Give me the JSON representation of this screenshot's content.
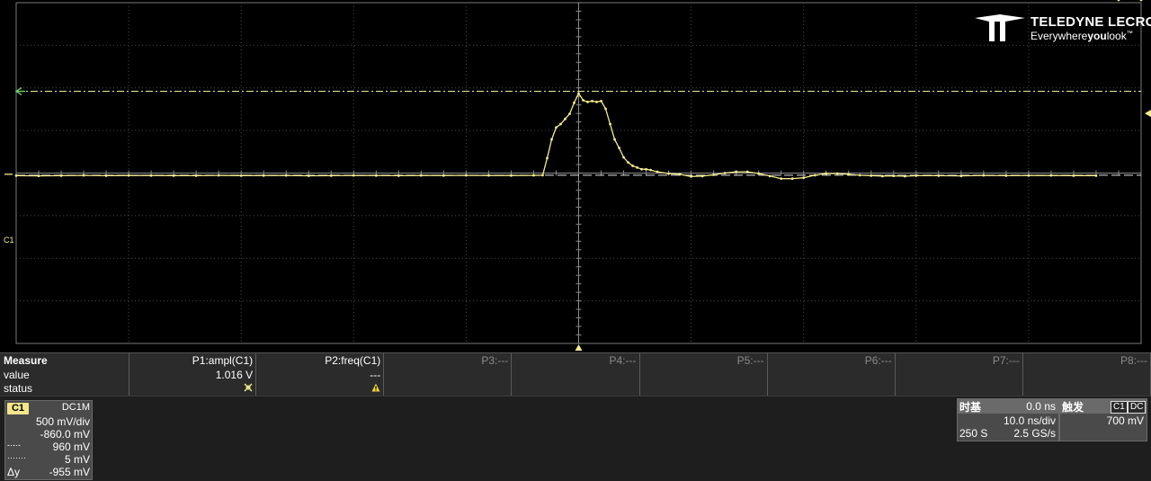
{
  "brand": {
    "name": "TELEDYNE LECROY",
    "tagline_pre": "Everywhere",
    "tagline_bold": "you",
    "tagline_post": "look"
  },
  "screen": {
    "channel_marker": "C1",
    "trace_color": "#f4ec8f",
    "grid_color": "#4a4a4a",
    "trace_level_y_div": -0.05,
    "cursor_level_y_div": 1.92,
    "trigger_level_y_div": 1.4,
    "trigger_time_div": 0
  },
  "waveform": {
    "type": "line",
    "xlim": [
      -50,
      50
    ],
    "ylim": [
      -2000,
      2000
    ],
    "x_unit": "ns",
    "y_unit": "mV",
    "x": [
      -50,
      -48,
      -46,
      -44,
      -42,
      -40,
      -38,
      -36,
      -34,
      -32,
      -30,
      -28,
      -26,
      -24,
      -22,
      -20,
      -18,
      -16,
      -14,
      -12,
      -10,
      -8,
      -6,
      -4,
      -3.2,
      -2.8,
      -2.4,
      -2,
      -1.6,
      -1.2,
      -0.8,
      -0.4,
      0,
      0.4,
      0.8,
      1.2,
      1.6,
      2,
      2.4,
      2.8,
      3.2,
      3.6,
      4,
      4.4,
      4.8,
      5.2,
      5.6,
      6,
      6.4,
      7,
      8,
      9,
      10,
      11,
      12,
      13,
      14,
      15,
      16,
      17,
      18,
      19,
      20,
      21,
      22,
      23,
      24,
      25,
      26,
      27,
      28,
      29,
      30,
      32,
      34,
      36,
      38,
      40,
      42,
      44,
      46,
      48,
      50
    ],
    "values": [
      -5,
      -8,
      -5,
      -2,
      -6,
      -3,
      -4,
      -5,
      -6,
      -2,
      -5,
      -4,
      -3,
      -7,
      -5,
      -3,
      -4,
      -6,
      -3,
      -4,
      -2,
      -3,
      -4,
      -2,
      0,
      200,
      420,
      560,
      600,
      660,
      720,
      850,
      960,
      880,
      860,
      870,
      860,
      870,
      780,
      600,
      420,
      320,
      210,
      150,
      110,
      90,
      70,
      70,
      60,
      40,
      20,
      10,
      -15,
      -10,
      5,
      25,
      40,
      40,
      20,
      -10,
      -40,
      -40,
      -30,
      0,
      20,
      20,
      10,
      0,
      -5,
      -10,
      -8,
      -12,
      -6,
      -5,
      -8,
      -2,
      -6,
      -4,
      -3,
      -5,
      -5
    ]
  },
  "measure": {
    "label": "Measure",
    "row_value": "value",
    "row_status": "status",
    "params": [
      {
        "name": "P1:ampl(C1)",
        "value": "1.016 V",
        "status_icon": "crossed-status-icon",
        "active": true
      },
      {
        "name": "P2:freq(C1)",
        "value": "---",
        "status_icon": "warning-icon",
        "active": true
      },
      {
        "name": "P3:---",
        "value": "",
        "status_icon": "",
        "active": false
      },
      {
        "name": "P4:---",
        "value": "",
        "status_icon": "",
        "active": false
      },
      {
        "name": "P5:---",
        "value": "",
        "status_icon": "",
        "active": false
      },
      {
        "name": "P6:---",
        "value": "",
        "status_icon": "",
        "active": false
      },
      {
        "name": "P7:---",
        "value": "",
        "status_icon": "",
        "active": false
      },
      {
        "name": "P8:---",
        "value": "",
        "status_icon": "",
        "active": false
      }
    ]
  },
  "channel": {
    "badge": "C1",
    "coupling": "DC1M",
    "vdiv": "500 mV/div",
    "offset": "-860.0 mV",
    "cursor_dashdot_label": "-·-·-",
    "cursor_dashdot_value": "960 mV",
    "cursor_dot_label": "·······",
    "cursor_dot_value": "5 mV",
    "delta_label": "Δy",
    "delta_value": "-955 mV",
    "badge_color": "#f2e58a"
  },
  "timebase": {
    "label": "时基",
    "delay": "0.0 ns",
    "tdiv": "10.0 ns/div",
    "samples": "250 S",
    "rate": "2.5 GS/s"
  },
  "trigger": {
    "label": "触发",
    "source": "C1",
    "coupling": "DC",
    "level": "700 mV"
  }
}
